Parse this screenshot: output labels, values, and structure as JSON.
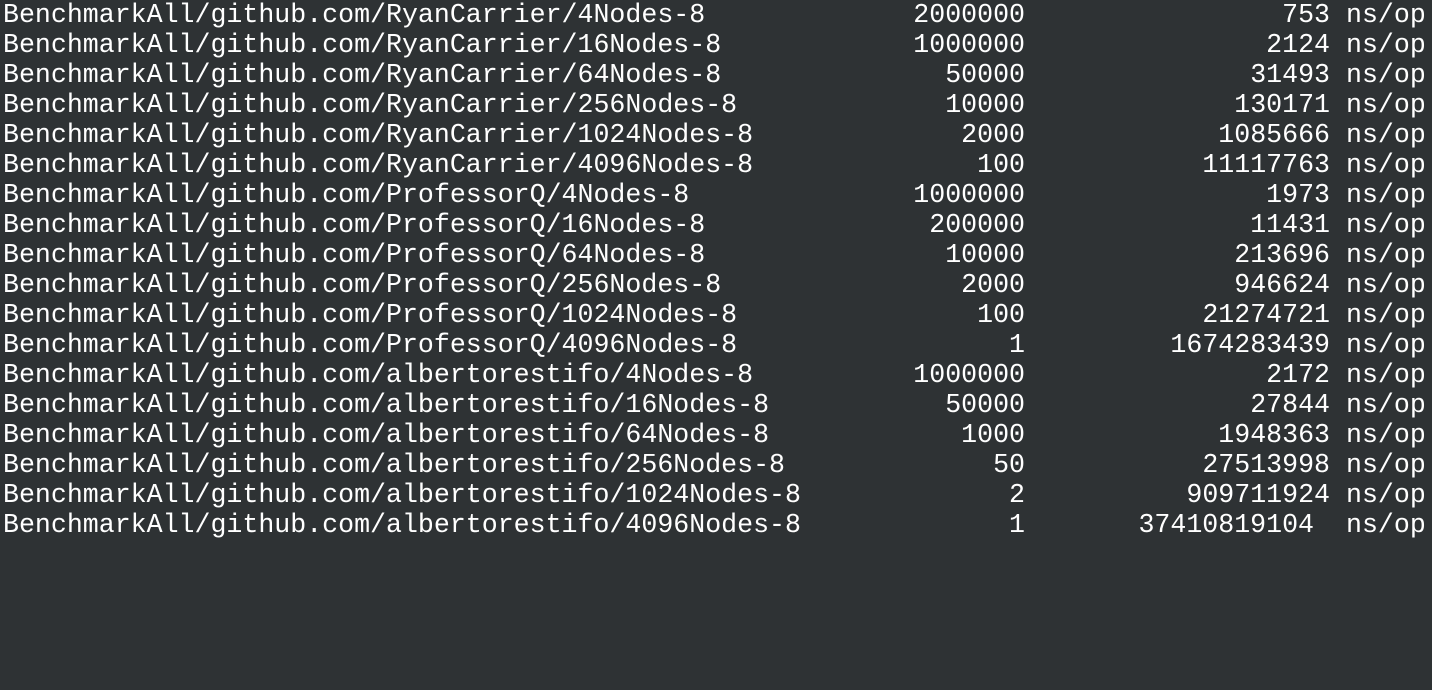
{
  "terminal": {
    "rows": [
      {
        "name": "BenchmarkAll/github.com/RyanCarrier/4Nodes-8",
        "iterations": "2000000",
        "ns": "753",
        "unit": "ns/op"
      },
      {
        "name": "BenchmarkAll/github.com/RyanCarrier/16Nodes-8",
        "iterations": "1000000",
        "ns": "2124",
        "unit": "ns/op"
      },
      {
        "name": "BenchmarkAll/github.com/RyanCarrier/64Nodes-8",
        "iterations": "50000",
        "ns": "31493",
        "unit": "ns/op"
      },
      {
        "name": "BenchmarkAll/github.com/RyanCarrier/256Nodes-8",
        "iterations": "10000",
        "ns": "130171",
        "unit": "ns/op"
      },
      {
        "name": "BenchmarkAll/github.com/RyanCarrier/1024Nodes-8",
        "iterations": "2000",
        "ns": "1085666",
        "unit": "ns/op"
      },
      {
        "name": "BenchmarkAll/github.com/RyanCarrier/4096Nodes-8",
        "iterations": "100",
        "ns": "11117763",
        "unit": "ns/op"
      },
      {
        "name": "BenchmarkAll/github.com/ProfessorQ/4Nodes-8",
        "iterations": "1000000",
        "ns": "1973",
        "unit": "ns/op"
      },
      {
        "name": "BenchmarkAll/github.com/ProfessorQ/16Nodes-8",
        "iterations": "200000",
        "ns": "11431",
        "unit": "ns/op"
      },
      {
        "name": "BenchmarkAll/github.com/ProfessorQ/64Nodes-8",
        "iterations": "10000",
        "ns": "213696",
        "unit": "ns/op"
      },
      {
        "name": "BenchmarkAll/github.com/ProfessorQ/256Nodes-8",
        "iterations": "2000",
        "ns": "946624",
        "unit": "ns/op"
      },
      {
        "name": "BenchmarkAll/github.com/ProfessorQ/1024Nodes-8",
        "iterations": "100",
        "ns": "21274721",
        "unit": "ns/op"
      },
      {
        "name": "BenchmarkAll/github.com/ProfessorQ/4096Nodes-8",
        "iterations": "1",
        "ns": "1674283439",
        "unit": "ns/op"
      },
      {
        "name": "BenchmarkAll/github.com/albertorestifo/4Nodes-8",
        "iterations": "1000000",
        "ns": "2172",
        "unit": "ns/op"
      },
      {
        "name": "BenchmarkAll/github.com/albertorestifo/16Nodes-8",
        "iterations": "50000",
        "ns": "27844",
        "unit": "ns/op"
      },
      {
        "name": "BenchmarkAll/github.com/albertorestifo/64Nodes-8",
        "iterations": "1000",
        "ns": "1948363",
        "unit": "ns/op"
      },
      {
        "name": "BenchmarkAll/github.com/albertorestifo/256Nodes-8",
        "iterations": "50",
        "ns": "27513998",
        "unit": "ns/op"
      },
      {
        "name": "BenchmarkAll/github.com/albertorestifo/1024Nodes-8",
        "iterations": "2",
        "ns": "909711924",
        "unit": "ns/op"
      },
      {
        "name": "BenchmarkAll/github.com/albertorestifo/4096Nodes-8",
        "iterations": "1",
        "ns": "37410819104",
        "unit": "ns/op"
      }
    ]
  }
}
